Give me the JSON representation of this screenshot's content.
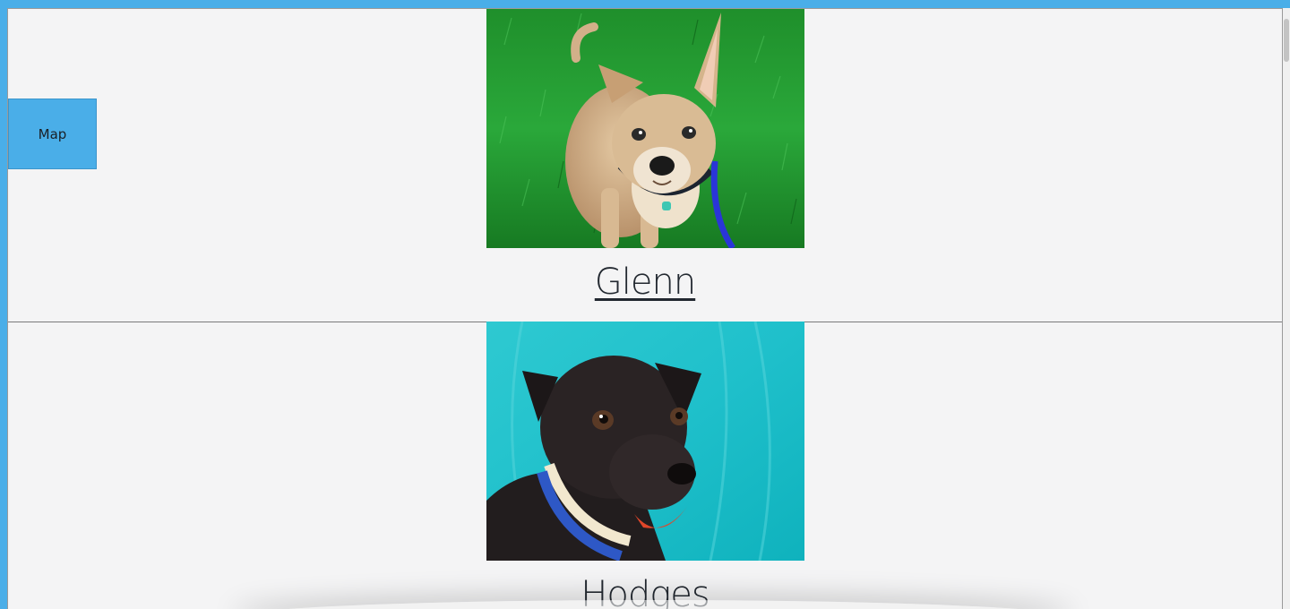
{
  "map_button": {
    "label": "Map"
  },
  "pets": [
    {
      "name": "Glenn",
      "photo": "tan-chihuahua-mix-on-grass"
    },
    {
      "name": "Hodges",
      "photo": "black-terrier-mix-on-teal-backdrop"
    }
  ],
  "colors": {
    "accent": "#4aaee8",
    "page_bg": "#f4f4f5",
    "text": "#222830"
  }
}
